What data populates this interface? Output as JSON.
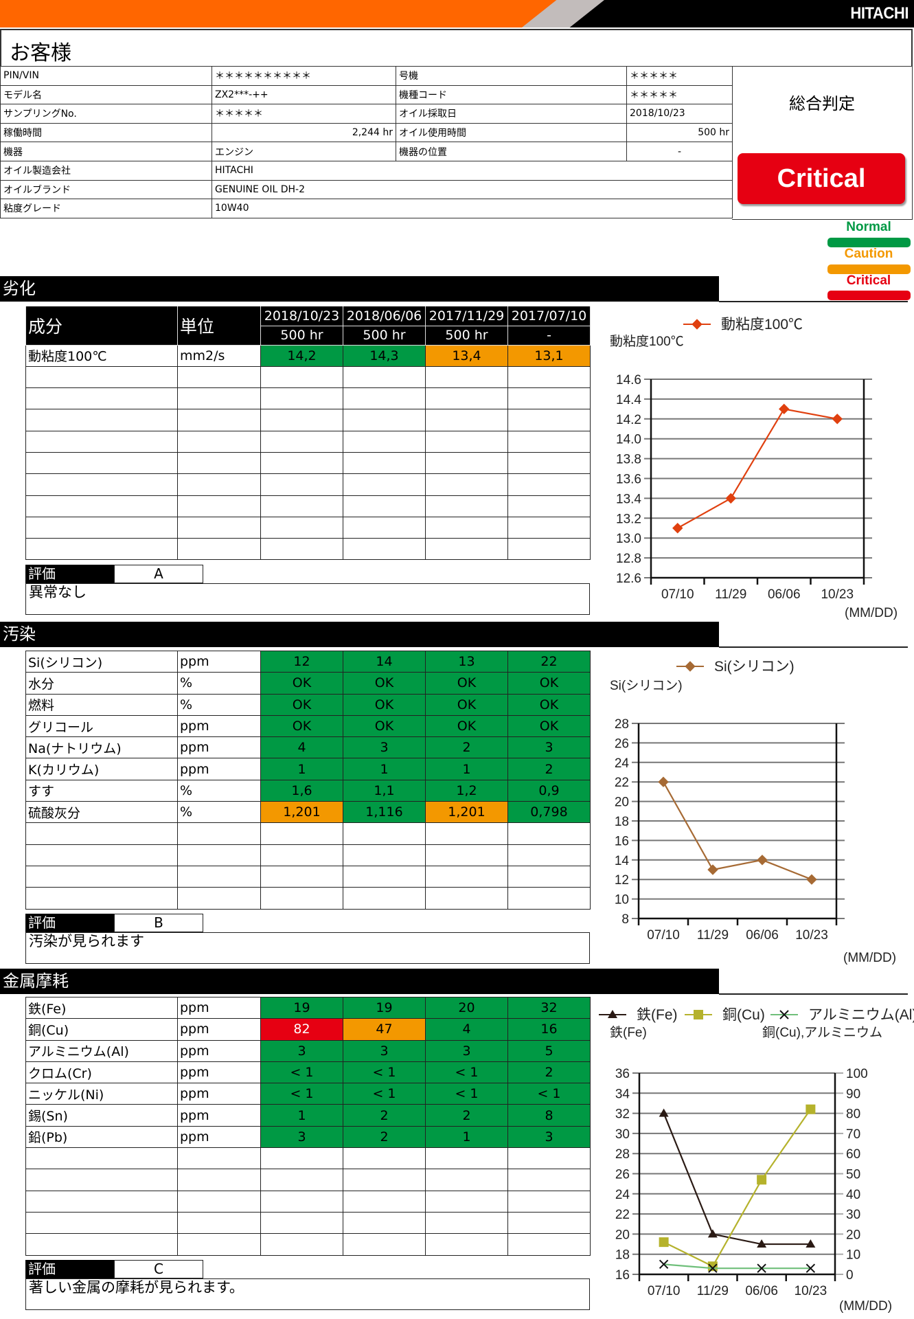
{
  "header": {
    "logo": "HITACHI",
    "customer_label": "お客様"
  },
  "info": {
    "rows": [
      {
        "l1": "PIN/VIN",
        "v1": "＊＊＊＊＊＊＊＊＊＊",
        "l2": "号機",
        "v2": "＊＊＊＊＊"
      },
      {
        "l1": "モデル名",
        "v1": "ZX2***-++",
        "l2": "機種コード",
        "v2": "＊＊＊＊＊"
      },
      {
        "l1": "サンプリングNo.",
        "v1": "＊＊＊＊＊",
        "l2": "オイル採取日",
        "v2": "2018/10/23"
      },
      {
        "l1": "稼働時間",
        "v1": "2,244 hr",
        "l2": "オイル使用時間",
        "v2": "500 hr"
      },
      {
        "l1": "機器",
        "v1": "エンジン",
        "l2": "機器の位置",
        "v2": "-"
      },
      {
        "l1": "オイル製造会社",
        "v1": "HITACHI"
      },
      {
        "l1": "オイルブランド",
        "v1": "GENUINE OIL DH-2"
      },
      {
        "l1": "粘度グレード",
        "v1": "10W40"
      }
    ]
  },
  "verdict": {
    "label": "総合判定",
    "value": "Critical"
  },
  "legend": [
    {
      "label": "Normal",
      "color": "#009944"
    },
    {
      "label": "Caution",
      "color": "#f39800"
    },
    {
      "label": "Critical",
      "color": "#e60012"
    }
  ],
  "table_header": {
    "component": "成分",
    "unit": "単位",
    "dates": [
      "2018/10/23",
      "2018/06/06",
      "2017/11/29",
      "2017/07/10"
    ],
    "hours": [
      "500 hr",
      "500 hr",
      "500 hr",
      "-"
    ]
  },
  "sections": [
    {
      "title": "劣化",
      "rows": [
        {
          "name": "動粘度100℃",
          "unit": "mm2/s",
          "values": [
            "14,2",
            "14,3",
            "13,4",
            "13,1"
          ],
          "status": [
            "normal",
            "normal",
            "caution",
            "caution"
          ]
        }
      ],
      "empty_rows": 9,
      "eval_label": "評価",
      "grade": "A",
      "comment": "異常なし"
    },
    {
      "title": "汚染",
      "rows": [
        {
          "name": "Si(シリコン)",
          "unit": "ppm",
          "values": [
            "12",
            "14",
            "13",
            "22"
          ],
          "status": [
            "normal",
            "normal",
            "normal",
            "normal"
          ]
        },
        {
          "name": "水分",
          "unit": "%",
          "values": [
            "OK",
            "OK",
            "OK",
            "OK"
          ],
          "status": [
            "normal",
            "normal",
            "normal",
            "normal"
          ]
        },
        {
          "name": "燃料",
          "unit": "%",
          "values": [
            "OK",
            "OK",
            "OK",
            "OK"
          ],
          "status": [
            "normal",
            "normal",
            "normal",
            "normal"
          ]
        },
        {
          "name": "グリコール",
          "unit": "ppm",
          "values": [
            "OK",
            "OK",
            "OK",
            "OK"
          ],
          "status": [
            "normal",
            "normal",
            "normal",
            "normal"
          ]
        },
        {
          "name": "Na(ナトリウム)",
          "unit": "ppm",
          "values": [
            "4",
            "3",
            "2",
            "3"
          ],
          "status": [
            "normal",
            "normal",
            "normal",
            "normal"
          ]
        },
        {
          "name": "K(カリウム)",
          "unit": "ppm",
          "values": [
            "1",
            "1",
            "1",
            "2"
          ],
          "status": [
            "normal",
            "normal",
            "normal",
            "normal"
          ]
        },
        {
          "name": "すす",
          "unit": "%",
          "values": [
            "1,6",
            "1,1",
            "1,2",
            "0,9"
          ],
          "status": [
            "normal",
            "normal",
            "normal",
            "normal"
          ]
        },
        {
          "name": "硫酸灰分",
          "unit": "%",
          "values": [
            "1,201",
            "1,116",
            "1,201",
            "0,798"
          ],
          "status": [
            "caution",
            "normal",
            "caution",
            "normal"
          ]
        }
      ],
      "empty_rows": 4,
      "eval_label": "評価",
      "grade": "B",
      "comment": "汚染が見られます"
    },
    {
      "title": "金属摩耗",
      "rows": [
        {
          "name": "鉄(Fe)",
          "unit": "ppm",
          "values": [
            "19",
            "19",
            "20",
            "32"
          ],
          "status": [
            "normal",
            "normal",
            "normal",
            "normal"
          ]
        },
        {
          "name": "銅(Cu)",
          "unit": "ppm",
          "values": [
            "82",
            "47",
            "4",
            "16"
          ],
          "status": [
            "critical",
            "caution",
            "normal",
            "normal"
          ]
        },
        {
          "name": "アルミニウム(Al)",
          "unit": "ppm",
          "values": [
            "3",
            "3",
            "3",
            "5"
          ],
          "status": [
            "normal",
            "normal",
            "normal",
            "normal"
          ]
        },
        {
          "name": "クロム(Cr)",
          "unit": "ppm",
          "values": [
            "< 1",
            "< 1",
            "< 1",
            "2"
          ],
          "status": [
            "normal",
            "normal",
            "normal",
            "normal"
          ]
        },
        {
          "name": "ニッケル(Ni)",
          "unit": "ppm",
          "values": [
            "< 1",
            "< 1",
            "< 1",
            "< 1"
          ],
          "status": [
            "normal",
            "normal",
            "normal",
            "normal"
          ]
        },
        {
          "name": "錫(Sn)",
          "unit": "ppm",
          "values": [
            "1",
            "2",
            "2",
            "8"
          ],
          "status": [
            "normal",
            "normal",
            "normal",
            "normal"
          ]
        },
        {
          "name": "鉛(Pb)",
          "unit": "ppm",
          "values": [
            "3",
            "2",
            "1",
            "3"
          ],
          "status": [
            "normal",
            "normal",
            "normal",
            "normal"
          ]
        }
      ],
      "empty_rows": 5,
      "eval_label": "評価",
      "grade": "C",
      "comment": "著しい金属の摩耗が見られます。"
    }
  ],
  "chart_data": [
    {
      "type": "line",
      "title": "",
      "legend": [
        "動粘度100℃"
      ],
      "ylabel": "動粘度100℃",
      "xlabel": "(MM/DD)",
      "categories": [
        "07/10",
        "11/29",
        "06/06",
        "10/23"
      ],
      "series": [
        {
          "name": "動粘度100℃",
          "values": [
            13.1,
            13.4,
            14.3,
            14.2
          ],
          "color": "#e0400f",
          "marker": "diamond"
        }
      ],
      "ylim": [
        12.6,
        14.6
      ],
      "yticks": [
        "12.6",
        "12.8",
        "13.0",
        "13.2",
        "13.4",
        "13.6",
        "13.8",
        "14.0",
        "14.2",
        "14.4",
        "14.6"
      ],
      "grid": true,
      "legend_position": "top"
    },
    {
      "type": "line",
      "title": "",
      "legend": [
        "Si(シリコン)"
      ],
      "ylabel": "Si(シリコン)",
      "xlabel": "(MM/DD)",
      "categories": [
        "07/10",
        "11/29",
        "06/06",
        "10/23"
      ],
      "series": [
        {
          "name": "Si(シリコン)",
          "values": [
            22,
            13,
            14,
            12
          ],
          "color": "#a66a34",
          "marker": "diamond"
        }
      ],
      "ylim": [
        8,
        28
      ],
      "yticks": [
        "8",
        "10",
        "12",
        "14",
        "16",
        "18",
        "20",
        "22",
        "24",
        "26",
        "28"
      ],
      "grid": true,
      "legend_position": "top"
    },
    {
      "type": "line",
      "title": "",
      "legend": [
        "鉄(Fe)",
        "銅(Cu)",
        "アルミニウム(Al)"
      ],
      "ylabel": "鉄(Fe)",
      "ylabel_right": "銅(Cu),アルミニウム",
      "xlabel": "(MM/DD)",
      "categories": [
        "07/10",
        "11/29",
        "06/06",
        "10/23"
      ],
      "series": [
        {
          "name": "鉄(Fe)",
          "values": [
            32,
            20,
            19,
            19
          ],
          "axis": "left",
          "color": "#2a1a14",
          "marker": "triangle"
        },
        {
          "name": "銅(Cu)",
          "values": [
            16,
            4,
            47,
            82
          ],
          "axis": "right",
          "color": "#b5b22c",
          "marker": "square"
        },
        {
          "name": "アルミニウム(Al)",
          "values": [
            5,
            3,
            3,
            3
          ],
          "axis": "right",
          "color": "#6fbf7a",
          "marker": "x"
        }
      ],
      "ylim": [
        16,
        36
      ],
      "ylim_right": [
        0,
        100
      ],
      "yticks": [
        "16",
        "18",
        "20",
        "22",
        "24",
        "26",
        "28",
        "30",
        "32",
        "34",
        "36"
      ],
      "yticks_right": [
        "0",
        "10",
        "20",
        "30",
        "40",
        "50",
        "60",
        "70",
        "80",
        "90",
        "100"
      ],
      "grid": true,
      "legend_position": "top"
    }
  ]
}
